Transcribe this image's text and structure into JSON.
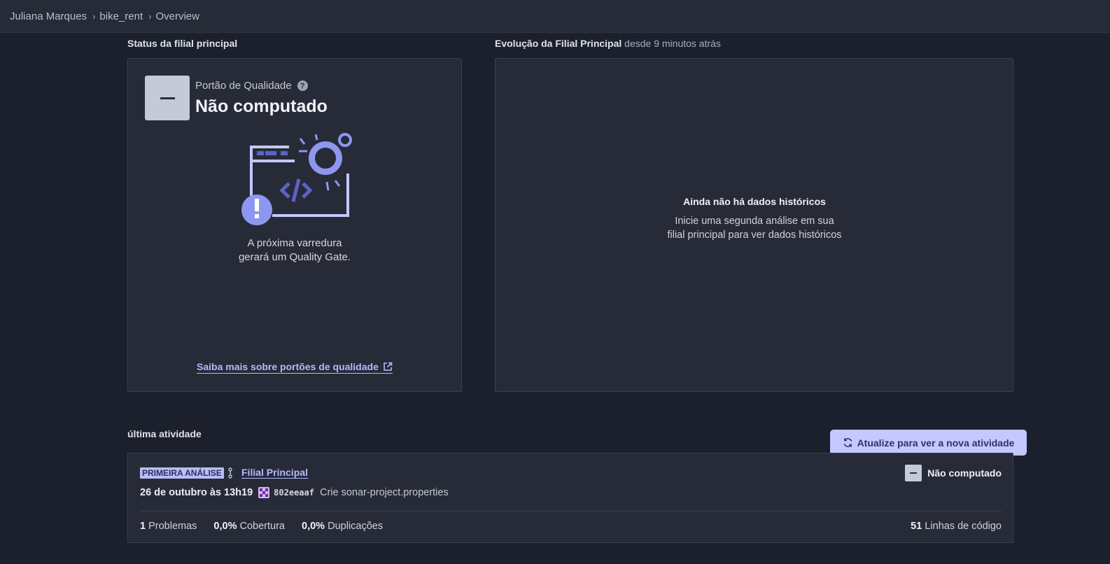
{
  "breadcrumb": {
    "owner": "Juliana Marques",
    "project": "bike_rent",
    "page": "Overview"
  },
  "main_branch_status": {
    "section_title": "Status da filial principal",
    "quality_gate_label": "Portão de Qualidade",
    "quality_gate_status": "Não computado",
    "scan_message_line1": "A próxima varredura",
    "scan_message_line2": "gerará um Quality Gate.",
    "learn_more_link": "Saiba mais sobre portões de qualidade"
  },
  "evolution": {
    "section_title": "Evolução da Filial Principal",
    "since": "desde 9 minutos atrás",
    "empty_title": "Ainda não há dados históricos",
    "empty_subtitle": "Inicie uma segunda análise em sua filial principal para ver dados históricos"
  },
  "activity": {
    "section_title": "última atividade",
    "refresh_button": "Atualize para ver a nova atividade",
    "badge": "PRIMEIRA ANÁLISE",
    "branch": "Filial Principal",
    "quality_gate": "Não computado",
    "date": "26 de outubro às 13h19",
    "commit_hash": "802eeaaf",
    "commit_message": "Crie sonar-project.properties",
    "metrics": {
      "issues_value": "1",
      "issues_label": "Problemas",
      "coverage_value": "0,0%",
      "coverage_label": "Cobertura",
      "duplications_value": "0,0%",
      "duplications_label": "Duplicações",
      "loc_value": "51",
      "loc_label": "Linhas de código"
    }
  },
  "colors": {
    "background": "#1c202d",
    "panel": "#272b38",
    "accent": "#b3bbff",
    "button": "#c3c8ff"
  },
  "icons": [
    "chevron-right-icon",
    "help-icon",
    "external-link-icon",
    "refresh-icon",
    "branch-icon",
    "commit-avatar-icon",
    "quality-gate-dash-icon"
  ]
}
